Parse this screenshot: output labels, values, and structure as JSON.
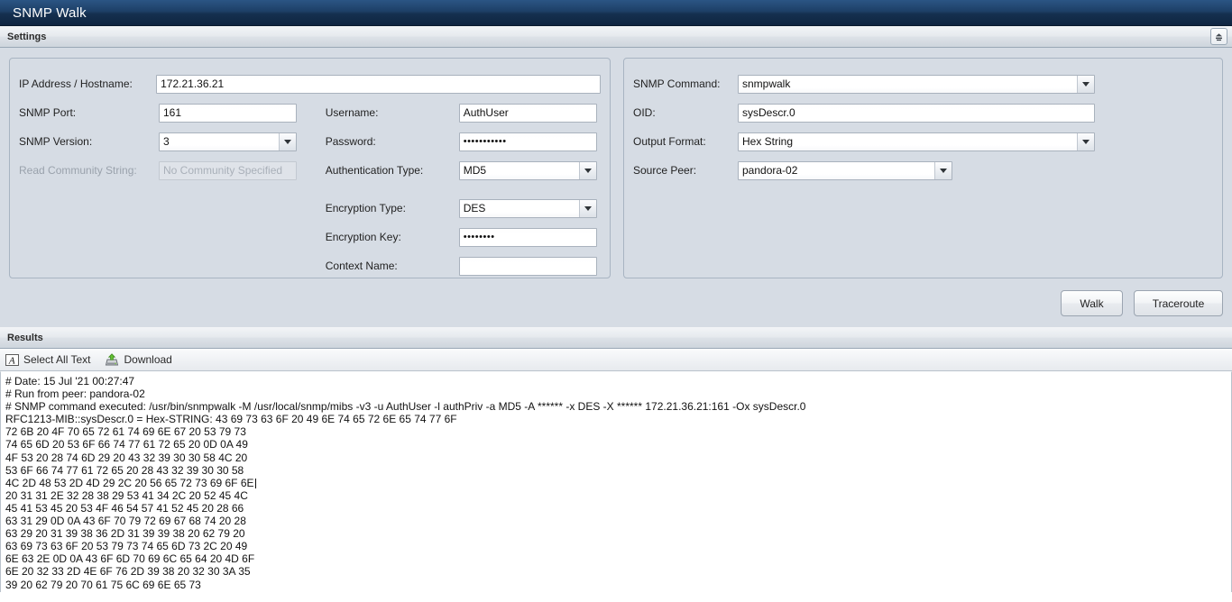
{
  "window": {
    "title": "SNMP Walk"
  },
  "settings": {
    "header": "Settings",
    "collapse_icon": "collapse-up-icon",
    "left_panel": {
      "ip_label": "IP Address / Hostname:",
      "ip_value": "172.21.36.21",
      "port_label": "SNMP Port:",
      "port_value": "161",
      "version_label": "SNMP Version:",
      "version_value": "3",
      "community_label": "Read Community String:",
      "community_placeholder": "No Community Specified",
      "username_label": "Username:",
      "username_value": "AuthUser",
      "password_label": "Password:",
      "password_value": "•••••••••••",
      "auth_type_label": "Authentication Type:",
      "auth_type_value": "MD5",
      "enc_type_label": "Encryption Type:",
      "enc_type_value": "DES",
      "enc_key_label": "Encryption Key:",
      "enc_key_value": "••••••••",
      "context_label": "Context Name:",
      "context_value": ""
    },
    "right_panel": {
      "command_label": "SNMP Command:",
      "command_value": "snmpwalk",
      "oid_label": "OID:",
      "oid_value": "sysDescr.0",
      "format_label": "Output Format:",
      "format_value": "Hex String",
      "peer_label": "Source Peer:",
      "peer_value": "pandora-02"
    },
    "buttons": {
      "walk": "Walk",
      "traceroute": "Traceroute"
    }
  },
  "results": {
    "header": "Results",
    "toolbar": {
      "select_all_label": "Select All Text",
      "select_all_icon": "select-text-icon",
      "download_label": "Download",
      "download_icon": "download-icon"
    },
    "lines": [
      "# Date: 15 Jul '21 00:27:47",
      "# Run from peer: pandora-02",
      "# SNMP command executed: /usr/bin/snmpwalk -M /usr/local/snmp/mibs -v3 -u AuthUser -l authPriv -a MD5 -A ****** -x DES -X ****** 172.21.36.21:161 -Ox sysDescr.0",
      "RFC1213-MIB::sysDescr.0 = Hex-STRING: 43 69 73 63 6F 20 49 6E 74 65 72 6E 65 74 77 6F",
      "72 6B 20 4F 70 65 72 61 74 69 6E 67 20 53 79 73",
      "74 65 6D 20 53 6F 66 74 77 61 72 65 20 0D 0A 49",
      "4F 53 20 28 74 6D 29 20 43 32 39 30 30 58 4C 20",
      "53 6F 66 74 77 61 72 65 20 28 43 32 39 30 30 58",
      "4C 2D 48 53 2D 4D 29 2C 20 56 65 72 73 69 6F 6E",
      "20 31 31 2E 32 28 38 29 53 41 34 2C 20 52 45 4C",
      "45 41 53 45 20 53 4F 46 54 57 41 52 45 20 28 66",
      "63 31 29 0D 0A 43 6F 70 79 72 69 67 68 74 20 28",
      "63 29 20 31 39 38 36 2D 31 39 39 38 20 62 79 20",
      "63 69 73 63 6F 20 53 79 73 74 65 6D 73 2C 20 49",
      "6E 63 2E 0D 0A 43 6F 6D 70 69 6C 65 64 20 4D 6F",
      "6E 20 32 33 2D 4E 6F 76 2D 39 38 20 32 30 3A 35",
      "39 20 62 79 20 70 61 75 6C 69 6E 65 73"
    ],
    "cursor_line_index": 8
  },
  "colors": {
    "titlebar": "#1d3f66",
    "settings_bg": "#d6dce4",
    "panel_border": "#a8b4c2",
    "download_accent": "#63c132"
  }
}
